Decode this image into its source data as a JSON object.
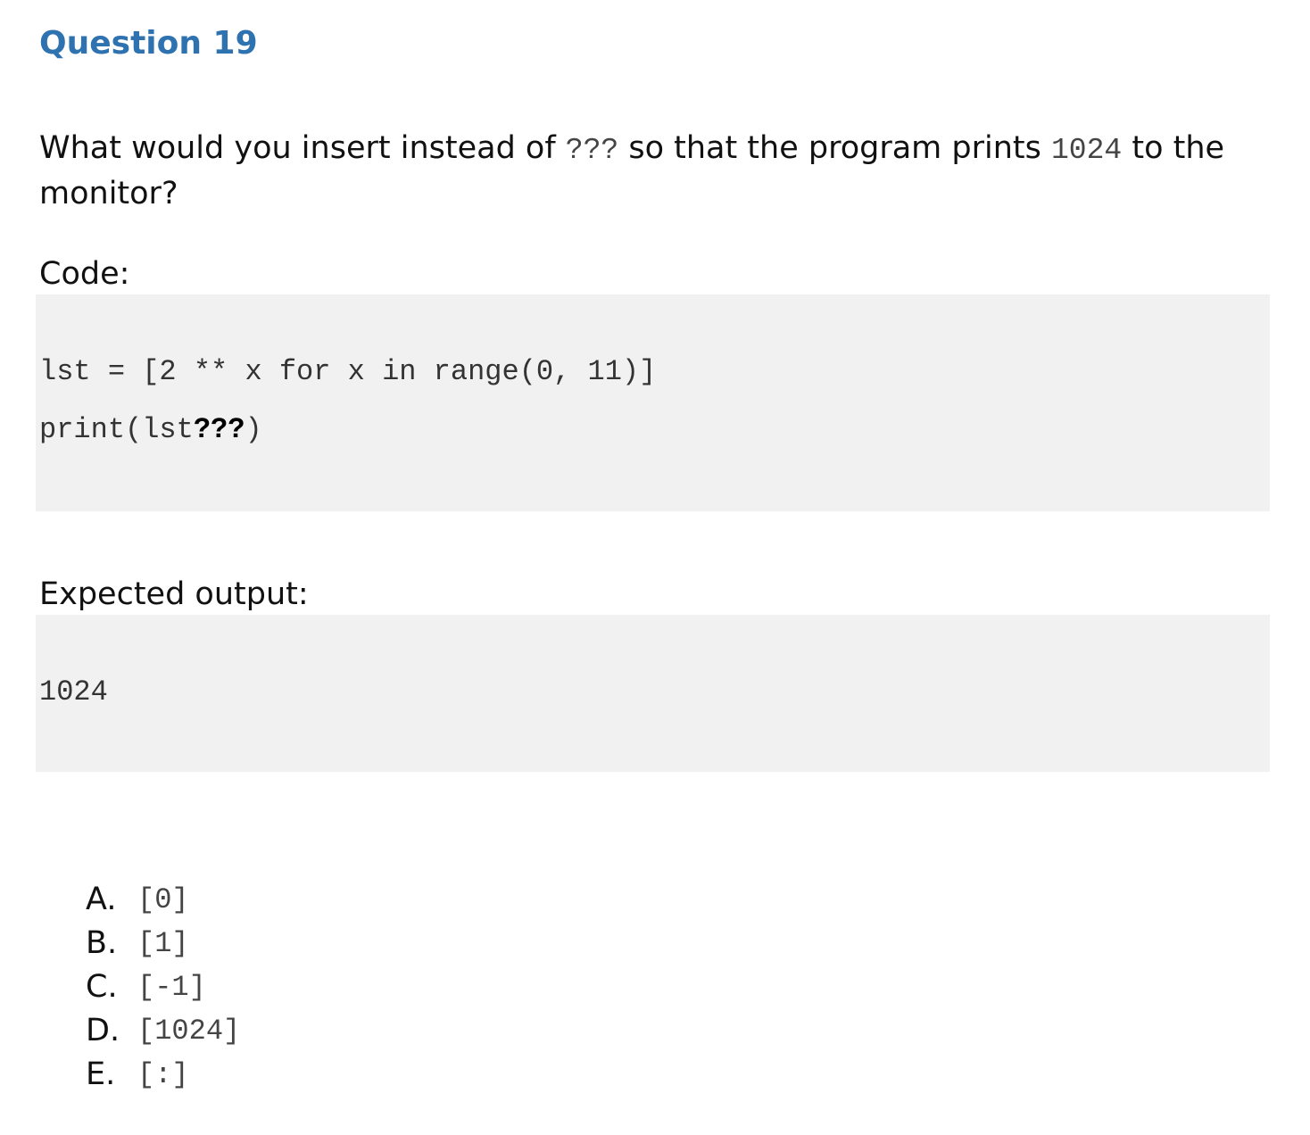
{
  "question": {
    "title": "Question 19",
    "prompt": {
      "part1": "What would you insert instead of ",
      "code1": "???",
      "part2": " so that the program prints ",
      "code2": "1024",
      "part3": " to the monitor?"
    },
    "code_label": "Code:",
    "code_lines": [
      {
        "text": "lst = [2 ** x for x in range(0, 11)]",
        "bold": ""
      },
      {
        "text": "print(lst",
        "bold": "???",
        "after": ")"
      }
    ],
    "output_label": "Expected output:",
    "output": "1024",
    "options": [
      {
        "letter": "A.",
        "value": "[0]"
      },
      {
        "letter": "B.",
        "value": "[1]"
      },
      {
        "letter": "C.",
        "value": "[-1]"
      },
      {
        "letter": "D.",
        "value": "[1024]"
      },
      {
        "letter": "E.",
        "value": "[:]"
      }
    ]
  },
  "colors": {
    "title": "#2f72b0",
    "code_background": "#f1f1f1"
  }
}
